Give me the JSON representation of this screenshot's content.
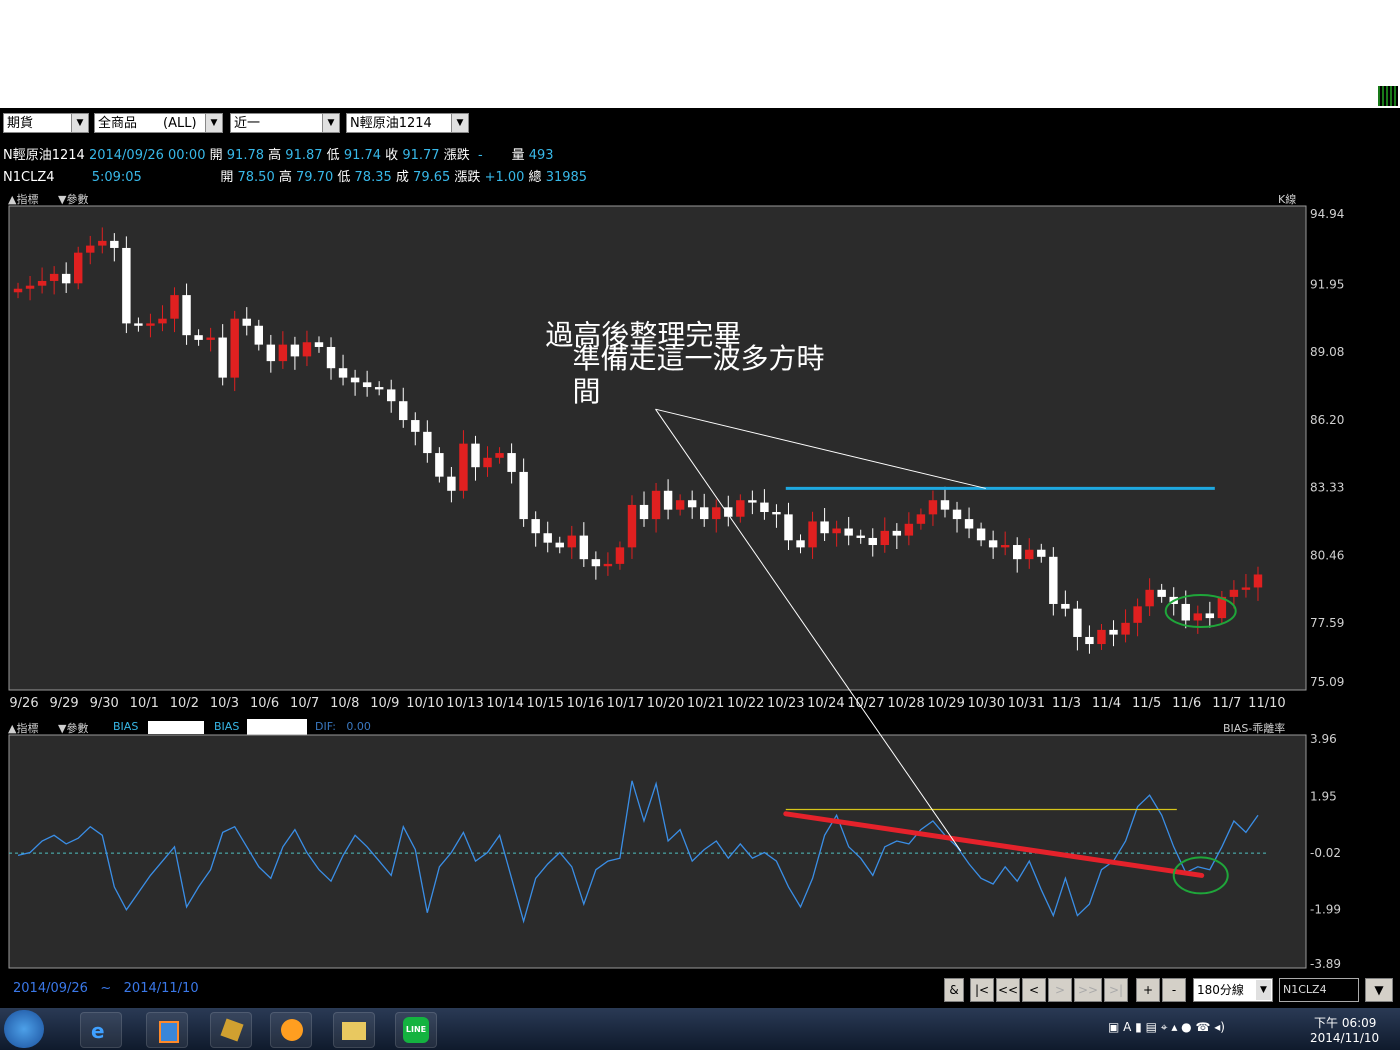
{
  "toolbar": {
    "selectors": [
      {
        "value": "期貨",
        "x": 3,
        "w": 86
      },
      {
        "value": "全商品　　(ALL)",
        "x": 94,
        "w": 129
      },
      {
        "value": "近一",
        "x": 230,
        "w": 110
      },
      {
        "value": "N輕原油1214",
        "x": 346,
        "w": 123
      }
    ]
  },
  "quote": {
    "row1": {
      "name": "N輕原油1214",
      "datetime": "2014/09/26 00:00",
      "open_label": "開",
      "open": "91.78",
      "high_label": "高",
      "high": "91.87",
      "low_label": "低",
      "low": "91.74",
      "close_label": "收",
      "close": "91.77",
      "change_label": "漲跌",
      "change": "-",
      "vol_label": "量",
      "vol": "493"
    },
    "row2": {
      "name": "N1CLZ4",
      "time": "5:09:05",
      "open_label": "開",
      "open": "78.50",
      "high_label": "高",
      "high": "79.70",
      "low_label": "低",
      "low": "78.35",
      "last_label": "成",
      "last": "79.65",
      "change_label": "漲跌",
      "change": "+1.00",
      "vol_label": "總",
      "vol": "31985"
    }
  },
  "panel_labels": {
    "indicator": "指標",
    "param": "參數",
    "k_title": "K線",
    "bias_label1": "BIAS",
    "bias_label2": "BIAS",
    "dif_label": "DIF:",
    "dif_value": "0.00",
    "bias_title": "BIAS-乖離率"
  },
  "footer": {
    "date_from": "2014/09/26",
    "tilde": "~",
    "date_to": "2014/11/10",
    "buttons": [
      "&",
      "|<",
      "<<",
      "<",
      ">",
      ">>",
      ">|",
      "+",
      "-"
    ],
    "interval": "180分線",
    "symbol": "N1CLZ4"
  },
  "taskbar": {
    "time": "下午 06:09",
    "date": "2014/11/10"
  },
  "colors": {
    "background": "#000000",
    "plot": "#2b2b2b",
    "candle_up": "#e02020",
    "candle_down": "#ffffff",
    "bias_line": "#3a8ee6",
    "resistance": "#1ea8e0",
    "trend_red": "#e5222b",
    "circle": "#1fa63a"
  },
  "chart_data": [
    {
      "type": "candlestick",
      "title": "K線",
      "x_ticks": [
        "9/26",
        "9/29",
        "9/30",
        "10/1",
        "10/2",
        "10/3",
        "10/6",
        "10/7",
        "10/8",
        "10/9",
        "10/10",
        "10/13",
        "10/14",
        "10/15",
        "10/16",
        "10/17",
        "10/20",
        "10/21",
        "10/22",
        "10/23",
        "10/24",
        "10/27",
        "10/28",
        "10/29",
        "10/30",
        "10/31",
        "11/3",
        "11/4",
        "11/5",
        "11/6",
        "11/7",
        "11/10"
      ],
      "y_ticks": [
        "94.94",
        "91.95",
        "89.08",
        "86.20",
        "83.33",
        "80.46",
        "77.59",
        "75.09"
      ],
      "ylim": [
        75.09,
        94.94
      ],
      "series_close": [
        91.77,
        91.9,
        92.1,
        92.4,
        92.0,
        93.3,
        93.6,
        93.8,
        93.5,
        90.3,
        90.2,
        90.3,
        90.5,
        91.5,
        89.8,
        89.6,
        89.7,
        88.0,
        90.5,
        90.2,
        89.4,
        88.7,
        89.4,
        88.9,
        89.5,
        89.3,
        88.4,
        88.0,
        87.8,
        87.6,
        87.5,
        87.0,
        86.2,
        85.7,
        84.8,
        83.8,
        83.2,
        85.2,
        84.2,
        84.6,
        84.8,
        84.0,
        82.0,
        81.4,
        81.0,
        80.8,
        81.3,
        80.3,
        80.0,
        80.1,
        80.8,
        82.6,
        82.0,
        83.2,
        82.4,
        82.8,
        82.5,
        82.0,
        82.5,
        82.1,
        82.8,
        82.7,
        82.3,
        82.2,
        81.1,
        80.8,
        81.9,
        81.4,
        81.6,
        81.3,
        81.2,
        80.9,
        81.5,
        81.3,
        81.8,
        82.2,
        82.8,
        82.4,
        82.0,
        81.6,
        81.1,
        80.8,
        80.9,
        80.3,
        80.7,
        80.4,
        78.4,
        78.2,
        77.0,
        76.7,
        77.3,
        77.1,
        77.6,
        78.3,
        79.0,
        78.7,
        78.4,
        77.7,
        78.0,
        77.8,
        78.7,
        79.0,
        79.1,
        79.65
      ],
      "annotations": [
        {
          "text": "過高後整理完畢",
          "anchor_date": "10/17",
          "y": 89.4
        },
        {
          "text": "準備走這一波多方時",
          "anchor_date": "10/20",
          "y": 88.4
        },
        {
          "text": "間",
          "anchor_date": "10/20",
          "y": 87.0
        },
        {
          "kind": "horizontal_line",
          "value": 83.3,
          "from": "10/23",
          "to": "11/7",
          "color": "#1ea8e0"
        },
        {
          "kind": "ellipse",
          "date": "11/6",
          "value": 78.1,
          "color": "#1fa63a"
        }
      ]
    },
    {
      "type": "line",
      "title": "BIAS-乖離率",
      "y_ticks": [
        "3.96",
        "1.95",
        "-0.02",
        "-1.99",
        "-3.89"
      ],
      "ylim": [
        -3.89,
        3.96
      ],
      "zero_line": -0.02,
      "series": [
        {
          "values": [
            -0.1,
            0.0,
            0.4,
            0.6,
            0.3,
            0.5,
            0.9,
            0.6,
            -1.2,
            -2.0,
            -1.4,
            -0.8,
            -0.3,
            0.2,
            -1.9,
            -1.2,
            -0.6,
            0.7,
            0.9,
            0.2,
            -0.5,
            -0.9,
            0.2,
            0.8,
            0.0,
            -0.6,
            -1.0,
            -0.1,
            0.6,
            0.2,
            -0.3,
            -0.8,
            0.9,
            0.1,
            -2.1,
            -0.5,
            0.0,
            0.7,
            -0.3,
            0.0,
            0.6,
            -0.9,
            -2.4,
            -0.9,
            -0.4,
            0.0,
            -0.5,
            -1.8,
            -0.6,
            -0.3,
            -0.2,
            2.5,
            1.1,
            2.4,
            0.4,
            0.8,
            -0.3,
            0.1,
            0.4,
            -0.2,
            0.3,
            -0.2,
            0.0,
            -0.3,
            -1.2,
            -1.9,
            -0.9,
            0.6,
            1.3,
            0.2,
            -0.2,
            -0.8,
            0.2,
            0.4,
            0.3,
            0.8,
            1.1,
            0.6,
            0.2,
            -0.4,
            -0.9,
            -1.1,
            -0.5,
            -1.0,
            -0.3,
            -1.3,
            -2.2,
            -0.9,
            -2.2,
            -1.8,
            -0.6,
            -0.3,
            0.4,
            1.6,
            2.0,
            1.3,
            0.2,
            -0.7,
            -0.5,
            -0.6,
            0.2,
            1.1,
            0.7,
            1.3
          ]
        }
      ],
      "annotations": [
        {
          "kind": "horizontal_line",
          "value": 1.5,
          "from": "10/23",
          "to": "11/7",
          "color": "#d6c41a"
        },
        {
          "kind": "trend_line",
          "from": [
            "10/23",
            1.35
          ],
          "to": [
            "11/6",
            -0.8
          ],
          "color": "#e5222b"
        },
        {
          "kind": "ellipse",
          "date": "11/6",
          "value": -0.8,
          "color": "#1fa63a"
        }
      ]
    }
  ]
}
